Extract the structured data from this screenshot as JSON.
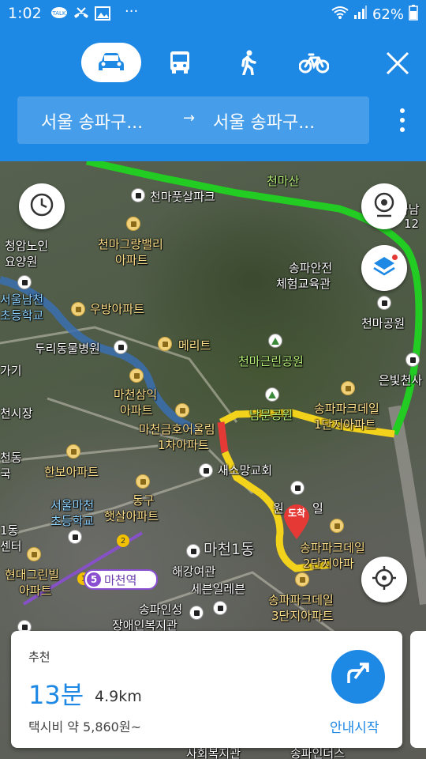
{
  "status": {
    "time": "1:02",
    "icons": [
      "talk-icon",
      "missed-call-icon",
      "image-icon",
      "more-icon"
    ],
    "battery": "62%"
  },
  "header": {
    "modes": [
      "car-icon",
      "bus-icon",
      "walk-icon",
      "bike-icon"
    ],
    "active_mode": "car",
    "route_from": "서울 송파구...",
    "route_arrow": "→",
    "route_to": "서울 송파구..."
  },
  "map": {
    "labels": {
      "l1": "천마산",
      "l2": "천마풋살파크",
      "l3": "청암노인",
      "l4": "요양원",
      "l5": "천마그랑밸리",
      "l6": "아파트",
      "l7": "서울남천",
      "l8": "초등학교",
      "l9": "우방아파트",
      "l10": "두리동물병원",
      "l11": "메리트",
      "l12": "송파안전",
      "l13": "체험교육관",
      "l14": "천마공원",
      "l15": "천마근린공원",
      "l16": "마천삼익",
      "l17": "아파트",
      "l18": "마천금호어울림",
      "l19": "1차아파트",
      "l20": "남문공원",
      "l21": "송파파크데일",
      "l22": "1단지아파트",
      "l23": "은빛천사",
      "l24": "천시장",
      "l25": "한보아파트",
      "l26": "새소망교회",
      "l27": "동구",
      "l28": "햇살아파트",
      "l29": "서울마천",
      "l30": "초등학교",
      "l31": "마천1동",
      "l32": "송파파크데일",
      "l33": "2단지아파",
      "l34": "현대그린빌",
      "l35": "아파트",
      "l36": "해강여관",
      "l37": "세븐일레븐",
      "l38": "송파인성",
      "l39": "장애인복지관",
      "l40": "송파파크데일",
      "l41": "3단지아파트",
      "l42": "천동",
      "l43": "국",
      "l44": "1동",
      "l45": "센터",
      "l46": "가기",
      "l47": "원",
      "l48": "일",
      "l49": "하남",
      "l50": "12",
      "l51": "사회복지관",
      "l52": "송파인더스"
    },
    "station_number": "5",
    "station_name": "마천역",
    "line_marker_1": "1",
    "line_marker_2": "2",
    "destination_label": "도착",
    "route_colors": {
      "fast": "#22cc22",
      "slow": "#f2d21b",
      "jam": "#e53935"
    }
  },
  "card": {
    "recommend": "추천",
    "time": "13분",
    "distance": "4.9km",
    "fare": "택시비 약 5,860원~",
    "start_label": "안내시작"
  }
}
